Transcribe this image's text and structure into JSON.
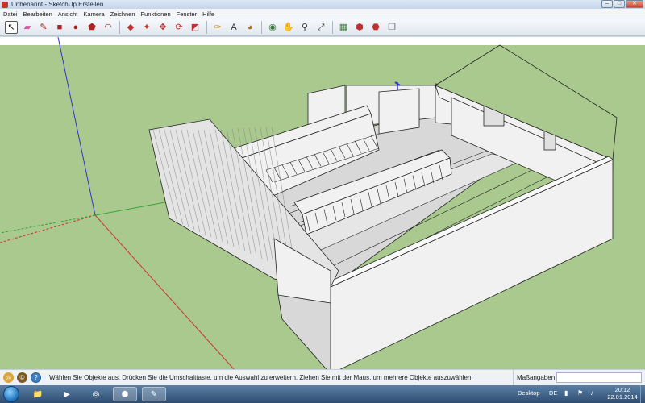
{
  "window": {
    "title": "Unbenannt - SketchUp Erstellen",
    "controls": {
      "minimize": "–",
      "maximize": "□",
      "close": "✕"
    }
  },
  "menu": {
    "items": [
      "Datei",
      "Bearbeiten",
      "Ansicht",
      "Kamera",
      "Zeichnen",
      "Funktionen",
      "Fenster",
      "Hilfe"
    ]
  },
  "toolbar": {
    "tools": [
      {
        "name": "select-tool",
        "glyph": "↖",
        "active": true
      },
      {
        "name": "eraser-tool",
        "glyph": "▰",
        "color": "#d45aa0"
      },
      {
        "name": "pencil-tool",
        "glyph": "✎",
        "color": "#b02020"
      },
      {
        "name": "rectangle-tool",
        "glyph": "■",
        "color": "#b02020"
      },
      {
        "name": "circle-tool",
        "glyph": "●",
        "color": "#b02020"
      },
      {
        "name": "polygon-tool",
        "glyph": "⬟",
        "color": "#b02020"
      },
      {
        "name": "arc-tool",
        "glyph": "◠",
        "color": "#b02020"
      },
      {
        "sep": true
      },
      {
        "name": "push-pull-tool",
        "glyph": "◆",
        "color": "#c03030"
      },
      {
        "name": "follow-me-tool",
        "glyph": "✦",
        "color": "#c03030"
      },
      {
        "name": "move-tool",
        "glyph": "✥",
        "color": "#c03030"
      },
      {
        "name": "rotate-tool",
        "glyph": "⟳",
        "color": "#c03030"
      },
      {
        "name": "scale-tool",
        "glyph": "◩",
        "color": "#c03030"
      },
      {
        "sep": true
      },
      {
        "name": "tape-measure-tool",
        "glyph": "✑",
        "color": "#c89020"
      },
      {
        "name": "text-tool",
        "glyph": "A",
        "color": "#333333"
      },
      {
        "name": "paint-bucket-tool",
        "glyph": "◕",
        "color": "#b07020"
      },
      {
        "sep": true
      },
      {
        "name": "orbit-tool",
        "glyph": "◉",
        "color": "#3a7a3a"
      },
      {
        "name": "pan-tool",
        "glyph": "✋",
        "color": "#a07040"
      },
      {
        "name": "zoom-tool",
        "glyph": "⚲",
        "color": "#333333"
      },
      {
        "name": "zoom-extents-tool",
        "glyph": "⤢",
        "color": "#333333"
      },
      {
        "sep": true
      },
      {
        "name": "get-models-tool",
        "glyph": "▦",
        "color": "#3a7a3a"
      },
      {
        "name": "share-model-tool",
        "glyph": "⬢",
        "color": "#c03030"
      },
      {
        "name": "extension-warehouse-tool",
        "glyph": "⬣",
        "color": "#c03030"
      },
      {
        "name": "layout-tool",
        "glyph": "❐",
        "color": "#777777"
      }
    ]
  },
  "scene": {
    "colors": {
      "ground": "#a9c98f",
      "sky": "#ffffff",
      "wall": "#f1f1f1",
      "floor": "#d8d8d8",
      "edge": "#222222",
      "axis_red": "#cc3333",
      "axis_green": "#3aa33a",
      "axis_blue": "#3333cc"
    }
  },
  "status": {
    "message": "Wählen Sie Objekte aus. Drücken Sie die Umschalttaste, um die Auswahl zu erweitern. Ziehen Sie mit der Maus, um mehrere Objekte auszuwählen.",
    "measurements_label": "Maßangaben",
    "measurements_value": ""
  },
  "taskbar": {
    "apps": [
      {
        "name": "explorer-taskbar-icon",
        "glyph": "📁",
        "running": false
      },
      {
        "name": "media-player-taskbar-icon",
        "glyph": "▶",
        "running": false
      },
      {
        "name": "chrome-taskbar-icon",
        "glyph": "◎",
        "running": false
      },
      {
        "name": "sketchup-taskbar-icon",
        "glyph": "⬢",
        "running": true
      },
      {
        "name": "paint-taskbar-icon",
        "glyph": "✎",
        "running": true
      }
    ],
    "desktop_label": "Desktop",
    "language": "DE",
    "time": "20:12",
    "date": "22.01.2014"
  }
}
